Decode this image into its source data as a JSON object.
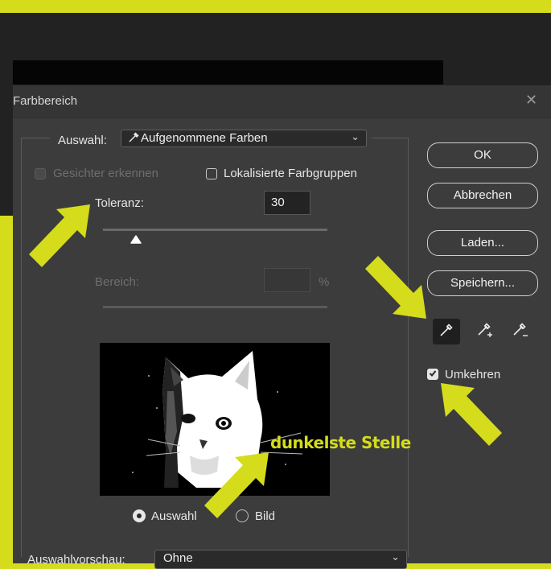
{
  "dialog": {
    "title": "Farbbereich",
    "close_icon": "close-icon"
  },
  "selection": {
    "label": "Auswahl:",
    "value": "Aufgenommene Farben",
    "icon": "eyedropper-icon"
  },
  "options": {
    "detect_faces": "Gesichter erkennen",
    "localized_groups": "Lokalisierte Farbgruppen",
    "invert": "Umkehren",
    "invert_checked": true
  },
  "tolerance": {
    "label": "Toleranz:",
    "value": "30",
    "slider_fraction": 0.15
  },
  "range": {
    "label": "Bereich:",
    "value": "",
    "unit": "%"
  },
  "buttons": {
    "ok": "OK",
    "cancel": "Abbrechen",
    "load": "Laden...",
    "save": "Speichern..."
  },
  "eyedroppers": [
    "eyedropper-icon",
    "eyedropper-plus-icon",
    "eyedropper-minus-icon"
  ],
  "view": {
    "selection": "Auswahl",
    "image": "Bild",
    "selected": "Auswahl"
  },
  "preview_select": {
    "label": "Auswahlvorschau:",
    "value": "Ohne"
  },
  "annotation": {
    "text": "dunkelste Stelle"
  },
  "colors": {
    "accent": "#d4dc1c",
    "dialog_bg": "#3c3c3c"
  }
}
